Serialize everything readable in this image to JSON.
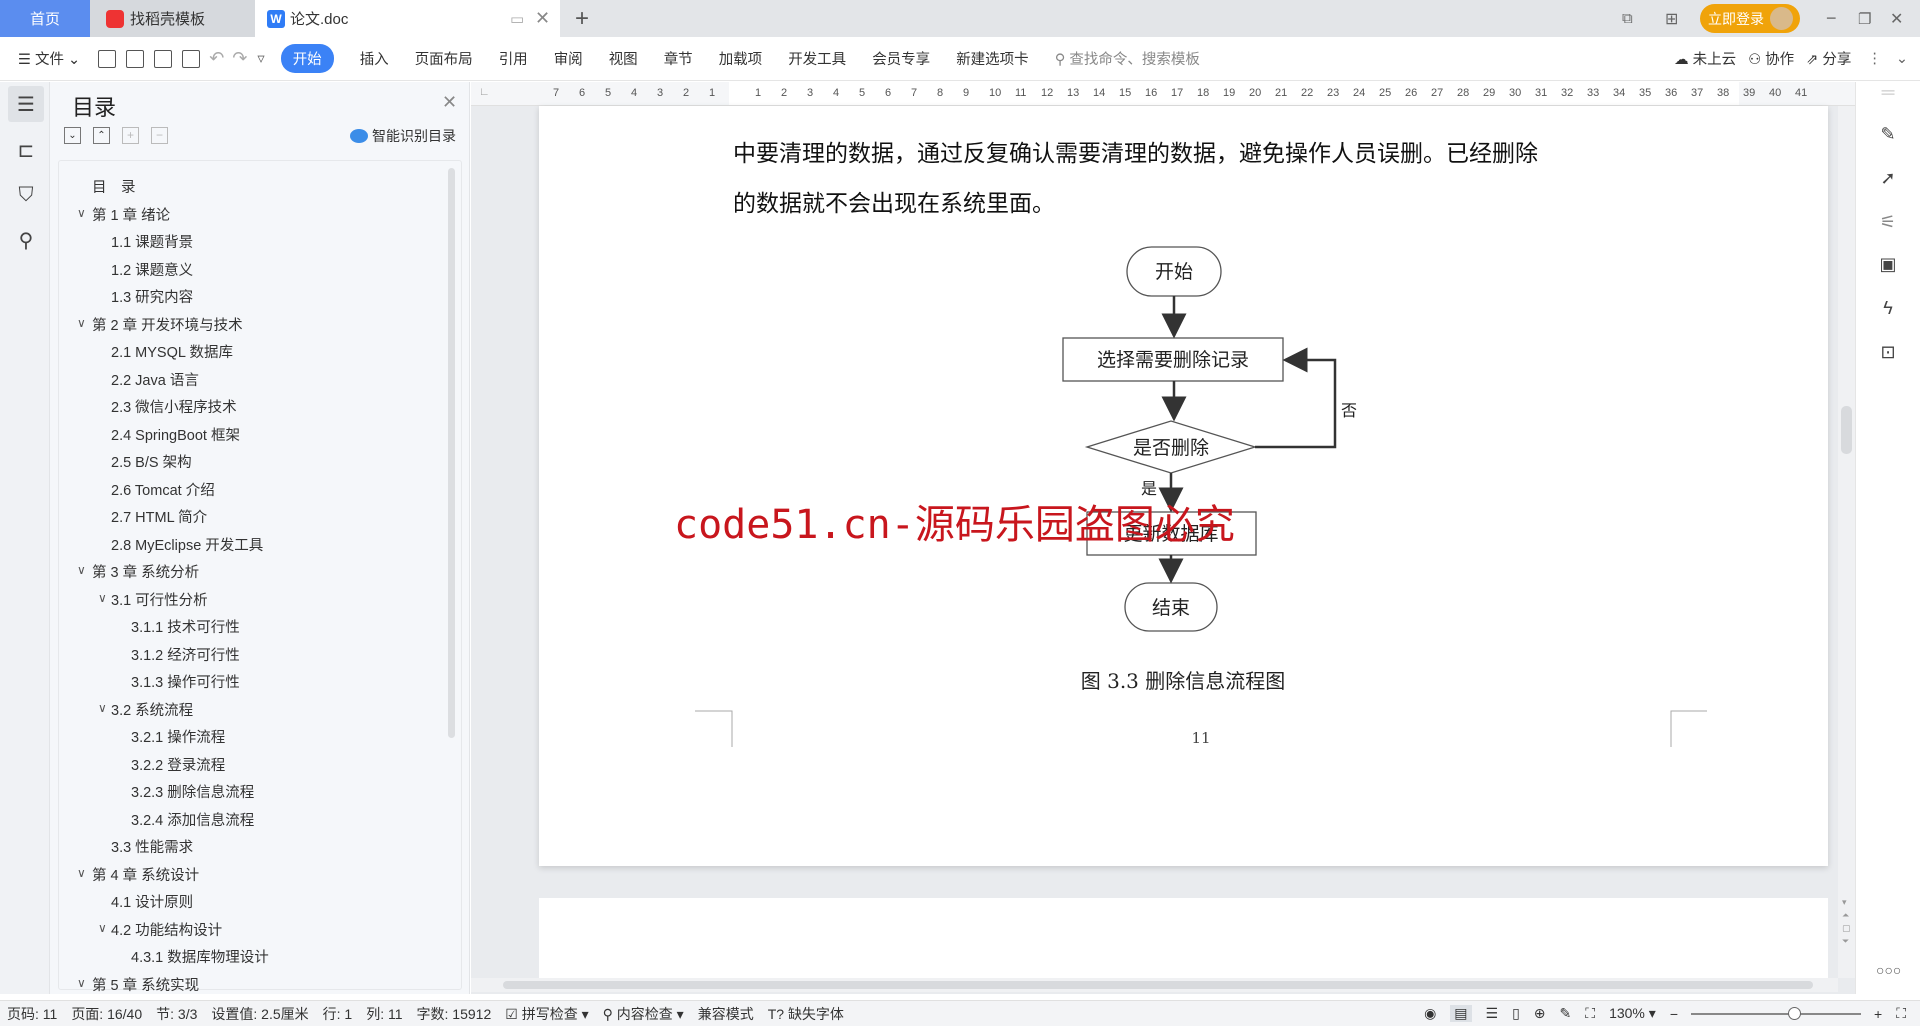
{
  "tabs": [
    {
      "label": "首页",
      "active": false
    },
    {
      "label": "找稻壳模板"
    },
    {
      "label": "论文.doc",
      "active": true
    }
  ],
  "titlebar": {
    "login": "立即登录"
  },
  "toolbar": {
    "file": "文件",
    "menus": [
      "开始",
      "插入",
      "页面布局",
      "引用",
      "审阅",
      "视图",
      "章节",
      "加载项",
      "开发工具",
      "会员专享",
      "新建选项卡"
    ],
    "search_placeholder": "查找命令、搜索模板",
    "cloud": "未上云",
    "collab": "协作",
    "share": "分享"
  },
  "toc_panel": {
    "title": "目录",
    "smart": "智能识别目录",
    "items": [
      {
        "label": "目　录",
        "level": 0
      },
      {
        "label": "第 1 章  绪论",
        "level": 1,
        "expanded": true
      },
      {
        "label": "1.1  课题背景",
        "level": 2
      },
      {
        "label": "1.2  课题意义",
        "level": 2
      },
      {
        "label": "1.3  研究内容",
        "level": 2
      },
      {
        "label": "第 2 章  开发环境与技术",
        "level": 1,
        "expanded": true
      },
      {
        "label": "2.1  MYSQL 数据库",
        "level": 2
      },
      {
        "label": "2.2  Java 语言",
        "level": 2
      },
      {
        "label": "2.3  微信小程序技术",
        "level": 2
      },
      {
        "label": "2.4  SpringBoot 框架",
        "level": 2
      },
      {
        "label": "2.5  B/S 架构",
        "level": 2
      },
      {
        "label": "2.6  Tomcat  介绍",
        "level": 2
      },
      {
        "label": "2.7  HTML 简介",
        "level": 2
      },
      {
        "label": "2.8  MyEclipse 开发工具",
        "level": 2
      },
      {
        "label": "第 3 章  系统分析",
        "level": 1,
        "expanded": true
      },
      {
        "label": "3.1  可行性分析",
        "level": 2,
        "expanded": true
      },
      {
        "label": "3.1.1  技术可行性",
        "level": 3
      },
      {
        "label": "3.1.2  经济可行性",
        "level": 3
      },
      {
        "label": "3.1.3  操作可行性",
        "level": 3
      },
      {
        "label": "3.2  系统流程",
        "level": 2,
        "expanded": true
      },
      {
        "label": "3.2.1  操作流程",
        "level": 3
      },
      {
        "label": "3.2.2  登录流程",
        "level": 3
      },
      {
        "label": "3.2.3  删除信息流程",
        "level": 3
      },
      {
        "label": "3.2.4  添加信息流程",
        "level": 3
      },
      {
        "label": "3.3  性能需求",
        "level": 2
      },
      {
        "label": "第 4 章  系统设计",
        "level": 1,
        "expanded": true
      },
      {
        "label": "4.1  设计原则",
        "level": 2
      },
      {
        "label": "4.2  功能结构设计",
        "level": 2,
        "expanded": true
      },
      {
        "label": "4.3.1  数据库物理设计",
        "level": 3
      },
      {
        "label": "第 5 章  系统实现",
        "level": 1,
        "expanded": true
      }
    ]
  },
  "ruler": {
    "left": [
      "7",
      "6",
      "5",
      "4",
      "3",
      "2",
      "1"
    ],
    "right": [
      "1",
      "2",
      "3",
      "4",
      "5",
      "6",
      "7",
      "8",
      "9",
      "10",
      "11",
      "12",
      "13",
      "14",
      "15",
      "16",
      "17",
      "18",
      "19",
      "20",
      "21",
      "22",
      "23",
      "24",
      "25",
      "26",
      "27",
      "28",
      "29",
      "30",
      "31",
      "32",
      "33",
      "34",
      "35",
      "36",
      "37",
      "38",
      "39",
      "40",
      "41"
    ]
  },
  "document": {
    "lines": [
      "中要清理的数据，通过反复确认需要清理的数据，避免操作人员误删。已经删除",
      "的数据就不会出现在系统里面。"
    ],
    "flowchart": {
      "start": "开始",
      "step1": "选择需要删除记录",
      "decision": "是否删除",
      "no": "否",
      "yes": "是",
      "step2": "更新数据库",
      "end": "结束"
    },
    "caption": "图 3.3  删除信息流程图",
    "page_number": "11",
    "watermark": "code51.cn-源码乐园盗图必究",
    "watermark_color": "#c8161d"
  },
  "statusbar": {
    "page_code": "页码: 11",
    "page": "页面: 16/40",
    "section": "节: 3/3",
    "setting": "设置值: 2.5厘米",
    "row": "行: 1",
    "col": "列: 11",
    "words": "字数: 15912",
    "spell": "拼写检查",
    "content": "内容检查",
    "compat": "兼容模式",
    "missing_font": "缺失字体",
    "zoom": "130%",
    "zoom_level": 0.62
  },
  "colors": {
    "accent": "#3b82f6",
    "home_tab": "#5b8def",
    "login": "#f0a30a"
  }
}
